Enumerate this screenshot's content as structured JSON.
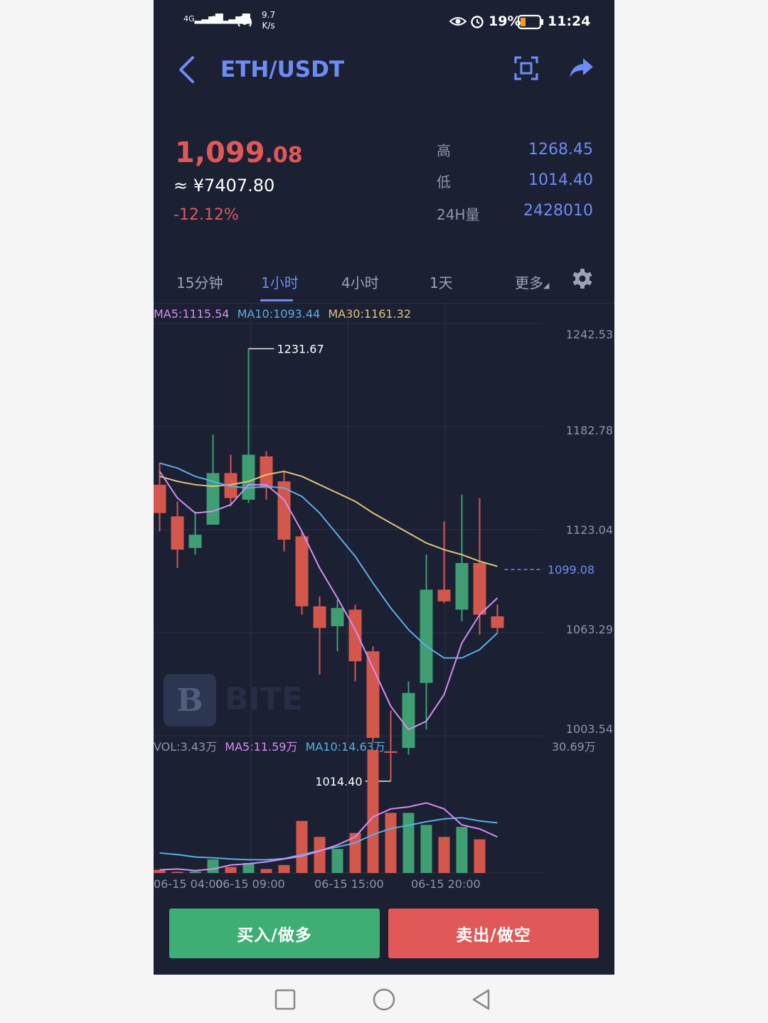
{
  "status_bar": {
    "signal1": "4G",
    "signal2": "4G",
    "net_speed_value": "9.7",
    "net_speed_unit": "K/s",
    "battery": "19%",
    "time": "11:24"
  },
  "header": {
    "title": "ETH/USDT",
    "back_icon": "chevron-left-icon",
    "screenshot_icon": "fullscreen-icon",
    "share_icon": "share-arrow-icon"
  },
  "ticker": {
    "price_int": "1,099",
    "price_dec": ".08",
    "cny": "≈ ¥7407.80",
    "change": "-12.12%",
    "high_label": "高",
    "high_value": "1268.45",
    "low_label": "低",
    "low_value": "1014.40",
    "vol_label": "24H量",
    "vol_value": "2428010"
  },
  "tabs": {
    "items": [
      "15分钟",
      "1小时",
      "4小时",
      "1天"
    ],
    "active": 1,
    "more": "更多",
    "settings_icon": "gear-icon"
  },
  "colors": {
    "bg": "#1b2033",
    "up": "#3f9e72",
    "down": "#d4574c",
    "ma5": "#d58df0",
    "ma10": "#5aaee6",
    "ma30": "#e3c27a",
    "accent": "#6d8df6",
    "buy": "#3fae74",
    "sell": "#e05858"
  },
  "legend": {
    "ma5": "MA5:1115.54",
    "ma10": "MA10:1093.44",
    "ma30": "MA30:1161.32",
    "vol": "VOL:3.43万",
    "vol_ma5": "MA5:11.59万",
    "vol_ma10": "MA10:14.63万"
  },
  "watermark": "BITE",
  "chart_data": {
    "type": "candlestick",
    "y_ticks": [
      "1242.53",
      "1182.78",
      "1123.04",
      "1063.29",
      "1003.54"
    ],
    "ylim": [
      1003.54,
      1242.53
    ],
    "x_ticks": [
      "06-15 04:00",
      "06-15 09:00",
      "06-15 15:00",
      "06-15 20:00"
    ],
    "max_label": "1231.67",
    "min_label": "1014.40",
    "last_price": "1099.08",
    "vol_axis_max": "30.69万",
    "vol_ylim": [
      0,
      30.69
    ],
    "candles": [
      {
        "o": 1150,
        "c": 1133,
        "h": 1163,
        "l": 1122
      },
      {
        "o": 1131,
        "c": 1111,
        "h": 1140,
        "l": 1100
      },
      {
        "o": 1112,
        "c": 1120,
        "h": 1134,
        "l": 1108
      },
      {
        "o": 1126,
        "c": 1157,
        "h": 1180,
        "l": 1126
      },
      {
        "o": 1157,
        "c": 1142,
        "h": 1168,
        "l": 1137
      },
      {
        "o": 1141,
        "c": 1168,
        "h": 1231.67,
        "l": 1139
      },
      {
        "o": 1167,
        "c": 1148,
        "h": 1170,
        "l": 1141
      },
      {
        "o": 1152,
        "c": 1117,
        "h": 1158,
        "l": 1110
      },
      {
        "o": 1119,
        "c": 1077,
        "h": 1122,
        "l": 1072
      },
      {
        "o": 1077,
        "c": 1064,
        "h": 1083,
        "l": 1036
      },
      {
        "o": 1065,
        "c": 1076,
        "h": 1081,
        "l": 1050
      },
      {
        "o": 1075,
        "c": 1044,
        "h": 1078,
        "l": 1032
      },
      {
        "o": 1050,
        "c": 998,
        "h": 1053,
        "l": 995
      },
      {
        "o": 990,
        "c": 989,
        "h": 1014.4,
        "l": 972
      },
      {
        "o": 992,
        "c": 1025,
        "h": 1032,
        "l": 988
      },
      {
        "o": 1031,
        "c": 1087,
        "h": 1108,
        "l": 1003
      },
      {
        "o": 1087,
        "c": 1080,
        "h": 1128,
        "l": 1079
      },
      {
        "o": 1075,
        "c": 1103,
        "h": 1144,
        "l": 1068
      },
      {
        "o": 1103,
        "c": 1072,
        "h": 1142,
        "l": 1060
      },
      {
        "o": 1071,
        "c": 1064,
        "h": 1078,
        "l": 1061
      }
    ],
    "volume": [
      {
        "v": 0.8,
        "up": false
      },
      {
        "v": 0.3,
        "up": false
      },
      {
        "v": 0.4,
        "up": true
      },
      {
        "v": 3.4,
        "up": true
      },
      {
        "v": 1.5,
        "up": false
      },
      {
        "v": 2.5,
        "up": true
      },
      {
        "v": 1.0,
        "up": false
      },
      {
        "v": 2.0,
        "up": false
      },
      {
        "v": 13.0,
        "up": false
      },
      {
        "v": 9.0,
        "up": false
      },
      {
        "v": 6.0,
        "up": true
      },
      {
        "v": 10.0,
        "up": false
      },
      {
        "v": 30.69,
        "up": false
      },
      {
        "v": 15.0,
        "up": false
      },
      {
        "v": 15.0,
        "up": true
      },
      {
        "v": 12.0,
        "up": true
      },
      {
        "v": 9.0,
        "up": false
      },
      {
        "v": 11.5,
        "up": true
      },
      {
        "v": 8.4,
        "up": false
      },
      {
        "v": 0,
        "up": false
      }
    ],
    "ma5": [
      1158,
      1142,
      1133,
      1134,
      1138,
      1150,
      1150,
      1141,
      1122,
      1100,
      1082,
      1063,
      1040,
      1017,
      1003,
      1008,
      1024,
      1055,
      1072,
      1082
    ],
    "ma10": [
      1163,
      1160,
      1155,
      1152,
      1149,
      1148,
      1149,
      1148,
      1143,
      1133,
      1120,
      1107,
      1091,
      1076,
      1063,
      1053,
      1046,
      1046,
      1051,
      1061
    ],
    "ma30": [
      1155,
      1152,
      1150,
      1149,
      1150,
      1152,
      1156,
      1158,
      1155,
      1150,
      1145,
      1140,
      1133,
      1127,
      1121,
      1115,
      1111,
      1108,
      1104,
      1101
    ],
    "vol_ma5": [
      0.8,
      1.0,
      0.6,
      1.0,
      2.0,
      2.3,
      2.8,
      3.5,
      4.2,
      5.5,
      7.0,
      9.0,
      14.0,
      16.0,
      16.5,
      17.5,
      16.0,
      12.0,
      11.0,
      9.0
    ],
    "vol_ma10": [
      5.0,
      4.6,
      4.0,
      3.8,
      3.5,
      3.3,
      3.3,
      3.6,
      4.6,
      5.6,
      6.5,
      7.5,
      9.6,
      11.1,
      11.9,
      12.8,
      13.5,
      13.8,
      13.0,
      12.5
    ]
  },
  "buttons": {
    "buy": "买入/做多",
    "sell": "卖出/做空"
  },
  "nav": {
    "square_icon": "recent-apps-icon",
    "circle_icon": "home-icon",
    "triangle_icon": "back-triangle-icon"
  }
}
